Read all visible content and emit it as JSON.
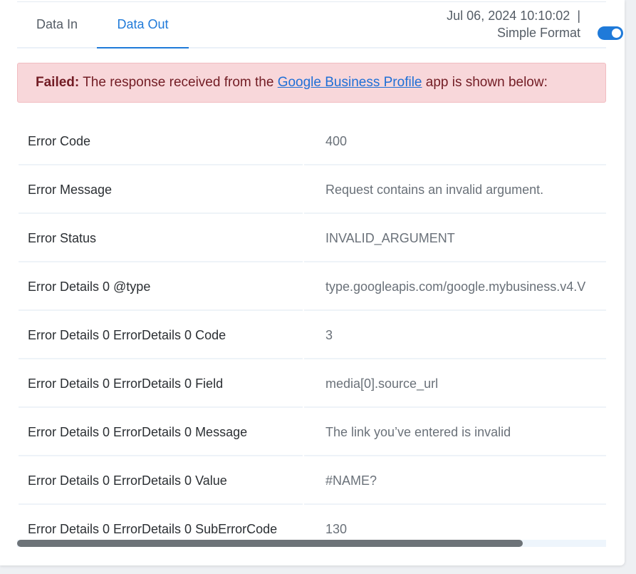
{
  "tabs": [
    {
      "label": "Data In"
    },
    {
      "label": "Data Out"
    }
  ],
  "meta": {
    "timestamp": "Jul 06, 2024 10:10:02",
    "separator": "|",
    "format_label": "Simple Format",
    "simple_format_on": true
  },
  "alert": {
    "status": "Failed:",
    "text_before": " The response received from the ",
    "link": "Google Business Profile",
    "text_after": " app is shown below:"
  },
  "rows": [
    {
      "key": "Error Code",
      "value": "400"
    },
    {
      "key": "Error Message",
      "value": "Request contains an invalid argument."
    },
    {
      "key": "Error Status",
      "value": "INVALID_ARGUMENT"
    },
    {
      "key": "Error Details 0 @type",
      "value": "type.googleapis.com/google.mybusiness.v4.V"
    },
    {
      "key": "Error Details 0 ErrorDetails 0 Code",
      "value": "3"
    },
    {
      "key": "Error Details 0 ErrorDetails 0 Field",
      "value": "media[0].source_url"
    },
    {
      "key": "Error Details 0 ErrorDetails 0 Message",
      "value": "The link you’ve entered is invalid"
    },
    {
      "key": "Error Details 0 ErrorDetails 0 Value",
      "value": "#NAME?"
    },
    {
      "key": "Error Details 0 ErrorDetails 0 SubErrorCode",
      "value": "130"
    }
  ],
  "colors": {
    "accent": "#1f7ad9",
    "alert_bg": "#f8d7da",
    "alert_text": "#721c24"
  },
  "icons": {
    "toggle": "toggle-switch-icon"
  }
}
